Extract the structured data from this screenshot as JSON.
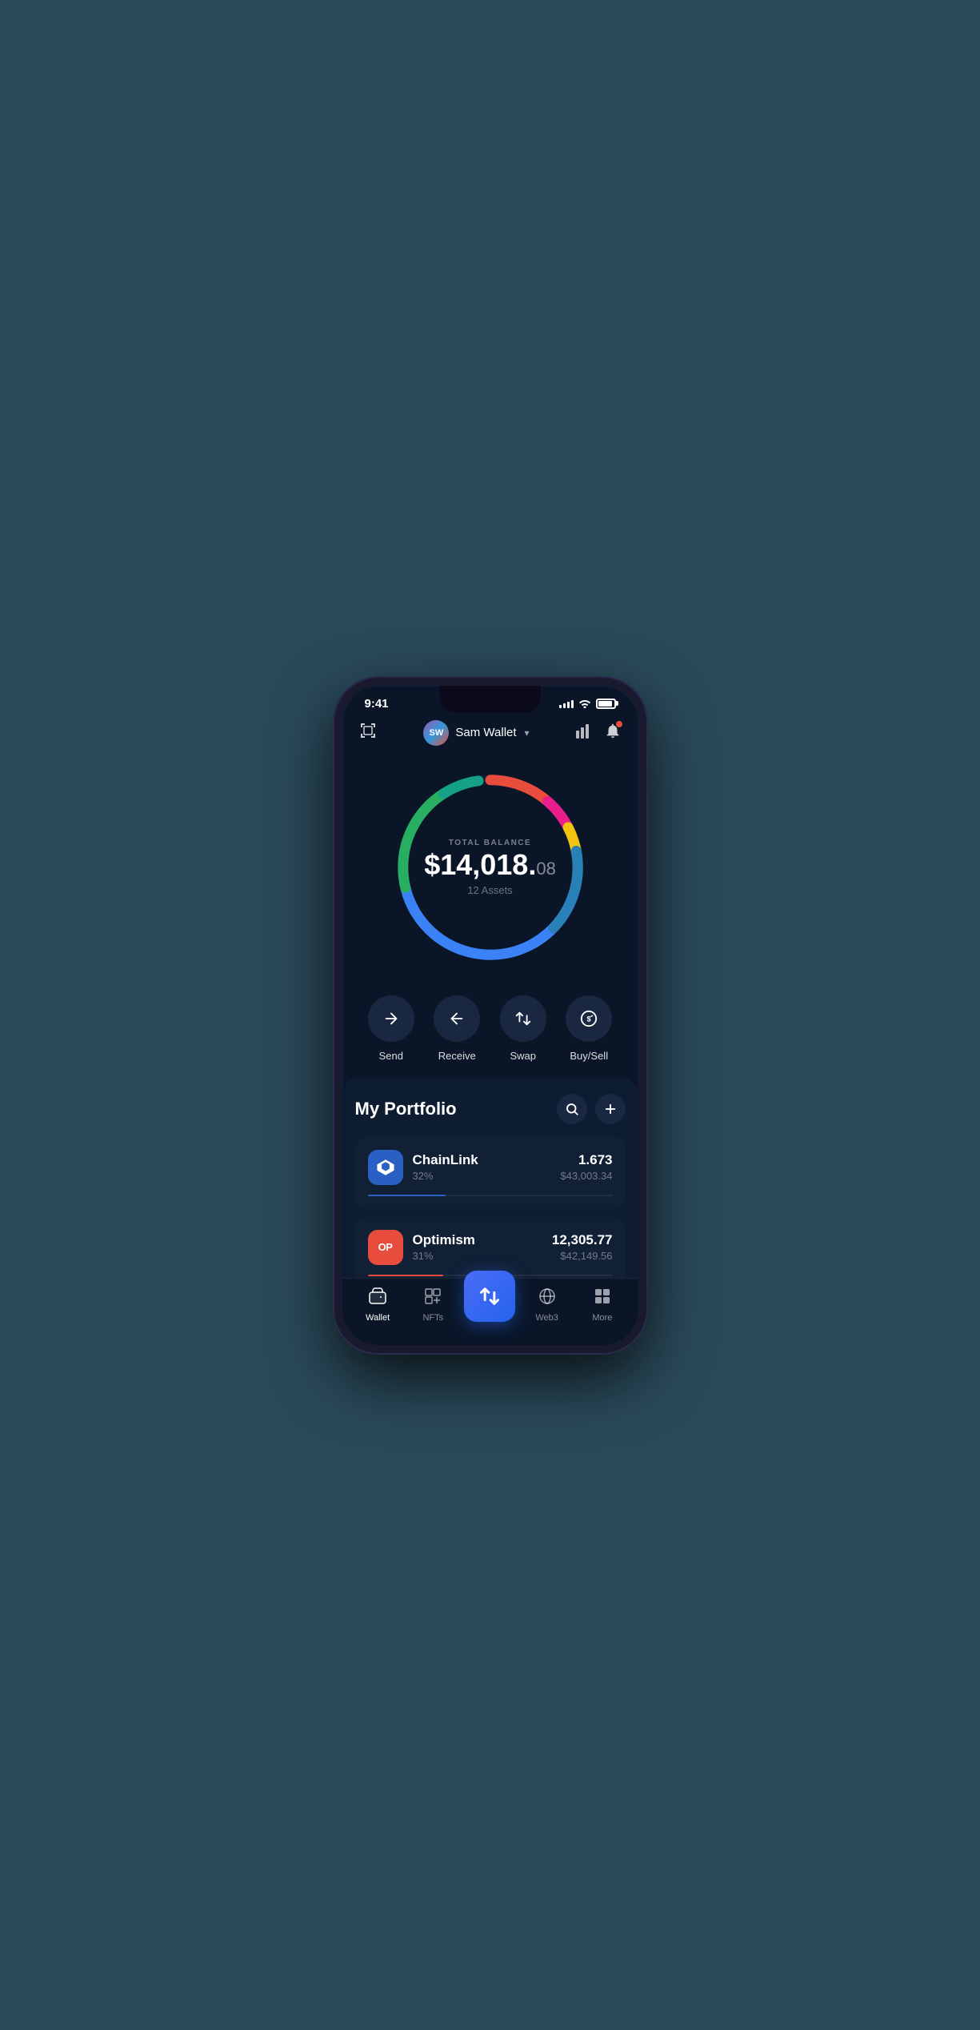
{
  "statusBar": {
    "time": "9:41",
    "signalBars": [
      3,
      5,
      7,
      9,
      11
    ],
    "batteryLevel": 90
  },
  "header": {
    "scanIconLabel": "scan",
    "userName": "Sam Wallet",
    "avatarInitials": "SW",
    "chartIconLabel": "chart",
    "bellIconLabel": "bell",
    "notificationCount": 1
  },
  "balance": {
    "label": "TOTAL BALANCE",
    "mainAmount": "$14,018.",
    "cents": "08",
    "assetsCount": "12 Assets"
  },
  "donut": {
    "segments": [
      {
        "color": "#e74c3c",
        "offset": 0,
        "length": 30
      },
      {
        "color": "#e74c3c",
        "offset": 30,
        "length": 35
      },
      {
        "color": "#f39c12",
        "offset": 65,
        "length": 20
      },
      {
        "color": "#f1c40f",
        "offset": 85,
        "length": 15
      },
      {
        "color": "#3498db",
        "offset": 100,
        "length": 100
      },
      {
        "color": "#27ae60",
        "offset": 200,
        "length": 80
      },
      {
        "color": "#2ecc71",
        "offset": 280,
        "length": 30
      },
      {
        "color": "#1abc9c",
        "offset": 310,
        "length": 30
      }
    ]
  },
  "actions": [
    {
      "id": "send",
      "label": "Send",
      "icon": "→"
    },
    {
      "id": "receive",
      "label": "Receive",
      "icon": "←"
    },
    {
      "id": "swap",
      "label": "Swap",
      "icon": "⇅"
    },
    {
      "id": "buysell",
      "label": "Buy/Sell",
      "icon": "$"
    }
  ],
  "portfolio": {
    "title": "My Portfolio",
    "searchLabel": "search",
    "addLabel": "add",
    "assets": [
      {
        "id": "chainlink",
        "name": "ChainLink",
        "pct": "32%",
        "amount": "1.673",
        "value": "$43,003.34",
        "progressColor": "#2a5fc4",
        "progressWidth": 32,
        "iconText": "⬡",
        "iconClass": "chainlink-icon"
      },
      {
        "id": "optimism",
        "name": "Optimism",
        "pct": "31%",
        "amount": "12,305.77",
        "value": "$42,149.56",
        "progressColor": "#e74c3c",
        "progressWidth": 31,
        "iconText": "OP",
        "iconClass": "optimism-icon"
      }
    ]
  },
  "bottomNav": [
    {
      "id": "wallet",
      "label": "Wallet",
      "icon": "👛",
      "active": true
    },
    {
      "id": "nfts",
      "label": "NFTs",
      "icon": "🖼",
      "active": false
    },
    {
      "id": "center",
      "label": "",
      "icon": "⇅",
      "active": false,
      "isCenter": true
    },
    {
      "id": "web3",
      "label": "Web3",
      "icon": "🌐",
      "active": false
    },
    {
      "id": "more",
      "label": "More",
      "icon": "⊞",
      "active": false
    }
  ]
}
